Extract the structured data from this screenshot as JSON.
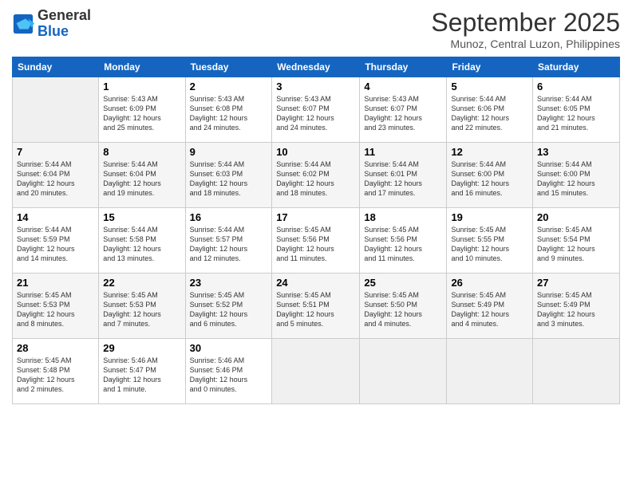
{
  "header": {
    "logo_line1": "General",
    "logo_line2": "Blue",
    "month": "September 2025",
    "location": "Munoz, Central Luzon, Philippines"
  },
  "weekdays": [
    "Sunday",
    "Monday",
    "Tuesday",
    "Wednesday",
    "Thursday",
    "Friday",
    "Saturday"
  ],
  "weeks": [
    [
      {
        "day": "",
        "info": ""
      },
      {
        "day": "1",
        "info": "Sunrise: 5:43 AM\nSunset: 6:09 PM\nDaylight: 12 hours\nand 25 minutes."
      },
      {
        "day": "2",
        "info": "Sunrise: 5:43 AM\nSunset: 6:08 PM\nDaylight: 12 hours\nand 24 minutes."
      },
      {
        "day": "3",
        "info": "Sunrise: 5:43 AM\nSunset: 6:07 PM\nDaylight: 12 hours\nand 24 minutes."
      },
      {
        "day": "4",
        "info": "Sunrise: 5:43 AM\nSunset: 6:07 PM\nDaylight: 12 hours\nand 23 minutes."
      },
      {
        "day": "5",
        "info": "Sunrise: 5:44 AM\nSunset: 6:06 PM\nDaylight: 12 hours\nand 22 minutes."
      },
      {
        "day": "6",
        "info": "Sunrise: 5:44 AM\nSunset: 6:05 PM\nDaylight: 12 hours\nand 21 minutes."
      }
    ],
    [
      {
        "day": "7",
        "info": "Sunrise: 5:44 AM\nSunset: 6:04 PM\nDaylight: 12 hours\nand 20 minutes."
      },
      {
        "day": "8",
        "info": "Sunrise: 5:44 AM\nSunset: 6:04 PM\nDaylight: 12 hours\nand 19 minutes."
      },
      {
        "day": "9",
        "info": "Sunrise: 5:44 AM\nSunset: 6:03 PM\nDaylight: 12 hours\nand 18 minutes."
      },
      {
        "day": "10",
        "info": "Sunrise: 5:44 AM\nSunset: 6:02 PM\nDaylight: 12 hours\nand 18 minutes."
      },
      {
        "day": "11",
        "info": "Sunrise: 5:44 AM\nSunset: 6:01 PM\nDaylight: 12 hours\nand 17 minutes."
      },
      {
        "day": "12",
        "info": "Sunrise: 5:44 AM\nSunset: 6:00 PM\nDaylight: 12 hours\nand 16 minutes."
      },
      {
        "day": "13",
        "info": "Sunrise: 5:44 AM\nSunset: 6:00 PM\nDaylight: 12 hours\nand 15 minutes."
      }
    ],
    [
      {
        "day": "14",
        "info": "Sunrise: 5:44 AM\nSunset: 5:59 PM\nDaylight: 12 hours\nand 14 minutes."
      },
      {
        "day": "15",
        "info": "Sunrise: 5:44 AM\nSunset: 5:58 PM\nDaylight: 12 hours\nand 13 minutes."
      },
      {
        "day": "16",
        "info": "Sunrise: 5:44 AM\nSunset: 5:57 PM\nDaylight: 12 hours\nand 12 minutes."
      },
      {
        "day": "17",
        "info": "Sunrise: 5:45 AM\nSunset: 5:56 PM\nDaylight: 12 hours\nand 11 minutes."
      },
      {
        "day": "18",
        "info": "Sunrise: 5:45 AM\nSunset: 5:56 PM\nDaylight: 12 hours\nand 11 minutes."
      },
      {
        "day": "19",
        "info": "Sunrise: 5:45 AM\nSunset: 5:55 PM\nDaylight: 12 hours\nand 10 minutes."
      },
      {
        "day": "20",
        "info": "Sunrise: 5:45 AM\nSunset: 5:54 PM\nDaylight: 12 hours\nand 9 minutes."
      }
    ],
    [
      {
        "day": "21",
        "info": "Sunrise: 5:45 AM\nSunset: 5:53 PM\nDaylight: 12 hours\nand 8 minutes."
      },
      {
        "day": "22",
        "info": "Sunrise: 5:45 AM\nSunset: 5:53 PM\nDaylight: 12 hours\nand 7 minutes."
      },
      {
        "day": "23",
        "info": "Sunrise: 5:45 AM\nSunset: 5:52 PM\nDaylight: 12 hours\nand 6 minutes."
      },
      {
        "day": "24",
        "info": "Sunrise: 5:45 AM\nSunset: 5:51 PM\nDaylight: 12 hours\nand 5 minutes."
      },
      {
        "day": "25",
        "info": "Sunrise: 5:45 AM\nSunset: 5:50 PM\nDaylight: 12 hours\nand 4 minutes."
      },
      {
        "day": "26",
        "info": "Sunrise: 5:45 AM\nSunset: 5:49 PM\nDaylight: 12 hours\nand 4 minutes."
      },
      {
        "day": "27",
        "info": "Sunrise: 5:45 AM\nSunset: 5:49 PM\nDaylight: 12 hours\nand 3 minutes."
      }
    ],
    [
      {
        "day": "28",
        "info": "Sunrise: 5:45 AM\nSunset: 5:48 PM\nDaylight: 12 hours\nand 2 minutes."
      },
      {
        "day": "29",
        "info": "Sunrise: 5:46 AM\nSunset: 5:47 PM\nDaylight: 12 hours\nand 1 minute."
      },
      {
        "day": "30",
        "info": "Sunrise: 5:46 AM\nSunset: 5:46 PM\nDaylight: 12 hours\nand 0 minutes."
      },
      {
        "day": "",
        "info": ""
      },
      {
        "day": "",
        "info": ""
      },
      {
        "day": "",
        "info": ""
      },
      {
        "day": "",
        "info": ""
      }
    ]
  ]
}
